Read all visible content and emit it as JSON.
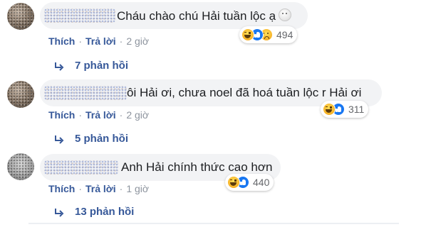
{
  "comments": [
    {
      "text": "Cháu chào chú Hải tuần lộc ạ",
      "like_label": "Thích",
      "reply_label": "Trả lời",
      "time": "2 giờ",
      "reaction_count": "494",
      "replies_label": "7 phản hồi",
      "reactions": [
        "haha-icon",
        "like-icon",
        "sad-icon"
      ]
    },
    {
      "text": "ôi Hải ơi, chưa noel đã hoá tuần lộc r Hải ơi",
      "like_label": "Thích",
      "reply_label": "Trả lời",
      "time": "2 giờ",
      "reaction_count": "311",
      "replies_label": "5 phản hồi",
      "reactions": [
        "haha-icon",
        "like-icon"
      ]
    },
    {
      "text": "Anh Hải chính thức cao hơn",
      "like_label": "Thích",
      "reply_label": "Trả lời",
      "time": "1 giờ",
      "reaction_count": "440",
      "replies_label": "13 phản hồi",
      "reactions": [
        "haha-icon",
        "like-icon"
      ]
    }
  ],
  "separator": "·",
  "colors": {
    "link": "#365899",
    "bubble": "#f2f3f5",
    "meta": "#8d949e",
    "like": "#1877f2"
  }
}
